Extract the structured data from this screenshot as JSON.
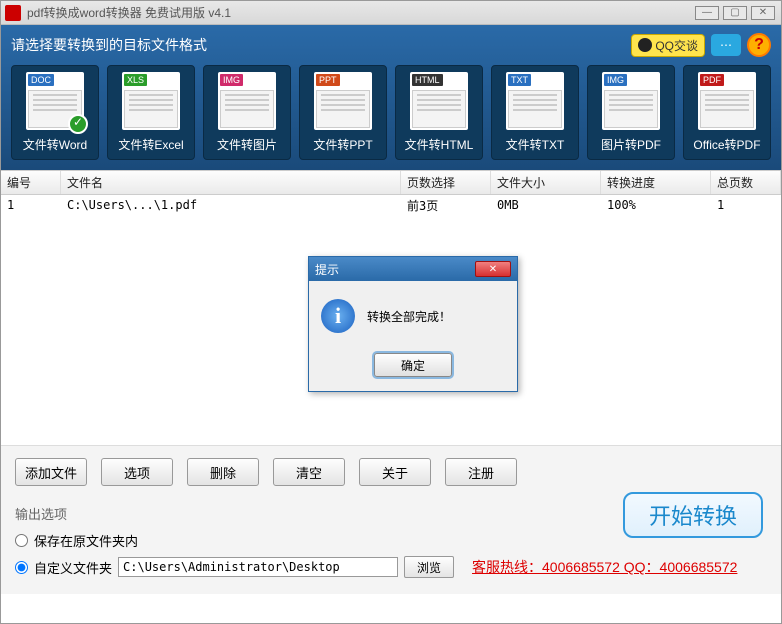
{
  "titlebar": {
    "title": "pdf转换成word转换器 免费试用版 v4.1"
  },
  "header": {
    "prompt": "请选择要转换到的目标文件格式",
    "qq_label": "QQ交谈",
    "help_char": "?"
  },
  "formats": [
    {
      "tag": "DOC",
      "tag_bg": "#2a70c0",
      "label": "文件转Word",
      "selected": true
    },
    {
      "tag": "XLS",
      "tag_bg": "#2a9d2a",
      "label": "文件转Excel"
    },
    {
      "tag": "IMG",
      "tag_bg": "#d02a6a",
      "label": "文件转图片"
    },
    {
      "tag": "PPT",
      "tag_bg": "#d04a1a",
      "label": "文件转PPT"
    },
    {
      "tag": "HTML",
      "tag_bg": "#333333",
      "label": "文件转HTML"
    },
    {
      "tag": "TXT",
      "tag_bg": "#2a70c0",
      "label": "文件转TXT"
    },
    {
      "tag": "IMG",
      "tag_bg": "#2a70c0",
      "label": "图片转PDF"
    },
    {
      "tag": "PDF",
      "tag_bg": "#c01a1a",
      "label": "Office转PDF"
    }
  ],
  "table": {
    "headers": {
      "num": "编号",
      "name": "文件名",
      "pages": "页数选择",
      "size": "文件大小",
      "prog": "转换进度",
      "total": "总页数"
    },
    "rows": [
      {
        "num": "1",
        "name": "C:\\Users\\...\\1.pdf",
        "pages": "前3页",
        "size": "0MB",
        "prog": "100%",
        "total": "1"
      }
    ]
  },
  "buttons": {
    "add": "添加文件",
    "opts": "选项",
    "del": "删除",
    "clear": "清空",
    "about": "关于",
    "reg": "注册"
  },
  "output": {
    "section_label": "输出选项",
    "radio_same": "保存在原文件夹内",
    "radio_custom": "自定义文件夹",
    "path": "C:\\Users\\Administrator\\Desktop",
    "browse": "浏览",
    "hotline": "客服热线：4006685572 QQ：4006685572",
    "start": "开始转换"
  },
  "modal": {
    "title": "提示",
    "message": "转换全部完成！",
    "ok": "确定"
  }
}
